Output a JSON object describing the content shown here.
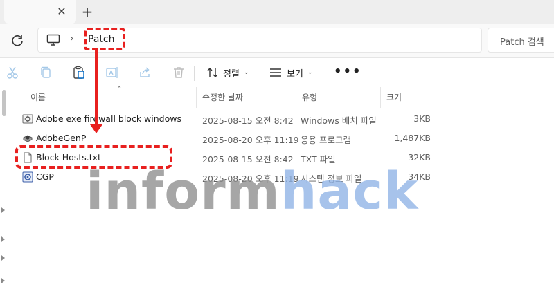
{
  "tab": {
    "close_glyph": "✕",
    "new_tab_glyph": "+"
  },
  "address": {
    "crumbs": [
      "Patch"
    ],
    "separator": "›"
  },
  "search": {
    "placeholder": "Patch 검색"
  },
  "commands": {
    "cut": "cut-icon",
    "copy": "copy-icon",
    "paste": "paste-icon",
    "rename": "rename-icon",
    "share": "share-icon",
    "delete": "delete-icon",
    "sort_label": "정렬",
    "view_label": "보기",
    "more_label": "•••"
  },
  "columns": {
    "name": "이름",
    "date": "수정한 날짜",
    "type": "유형",
    "size": "크기"
  },
  "files": [
    {
      "name": "Adobe exe firewall block windows",
      "date": "2025-08-15 오전 8:42",
      "type": "Windows 배치 파일",
      "size": "3KB",
      "icon": "batch-file-icon"
    },
    {
      "name": "AdobeGenP",
      "date": "2025-08-20 오후 11:19",
      "type": "응용 프로그램",
      "size": "1,487KB",
      "icon": "application-icon"
    },
    {
      "name": "Block Hosts.txt",
      "date": "2025-08-15 오전 8:42",
      "type": "TXT 파일",
      "size": "32KB",
      "icon": "text-file-icon"
    },
    {
      "name": "CGP",
      "date": "2025-08-20 오후 11:19",
      "type": "시스템 정보 파일",
      "size": "34KB",
      "icon": "system-info-icon"
    }
  ],
  "watermark": {
    "part1": "inform",
    "part2": "hack"
  },
  "colors": {
    "highlight": "#e8201f",
    "accent": "#0067c0"
  }
}
